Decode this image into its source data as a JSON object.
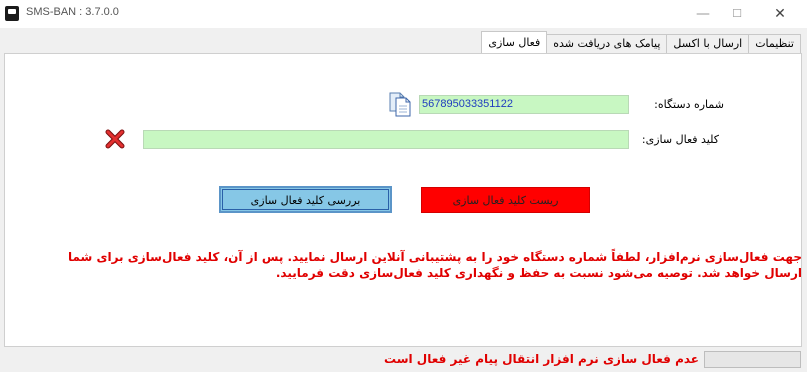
{
  "window": {
    "title": "SMS-BAN : 3.7.0.0",
    "minimize_symbol": "—",
    "maximize_symbol": "☐",
    "close_symbol": "✕"
  },
  "tabs": [
    {
      "label": "تنظیمات"
    },
    {
      "label": "ارسال با اکسل"
    },
    {
      "label": "پیامک های دریافت شده"
    },
    {
      "label": "فعال سازی"
    }
  ],
  "active_tab": "فعال سازی",
  "activation": {
    "device_label": "شماره دستگاه:",
    "device_number": "567895033351122",
    "key_label": "کلید فعال سازی:",
    "key_value": "",
    "check_button": "بررسی کلید فعال سازی",
    "reset_button": "ریست کلید فعال سازی",
    "info_text": "جهت فعال‌سازی نرم‌افزار، لطفاً شماره دستگاه خود را به پشتیبانی آنلاین ارسال نمایید. پس از آن، کلید فعال‌سازی برای شما ارسال خواهد شد. توصیه می‌شود نسبت به حفظ و نگهداری کلید فعال‌سازی دقت فرمایید.",
    "copy_icon": "copy-document-icon",
    "status_icon": "red-x-icon"
  },
  "status_bar": {
    "text": "عدم فعال سازی نرم افزار انتقال پیام غیر فعال است"
  },
  "colors": {
    "input_bg": "#c8f7c2",
    "check_button": "#86c7e6",
    "reset_button": "#ff0000",
    "info_text": "#e00000"
  }
}
